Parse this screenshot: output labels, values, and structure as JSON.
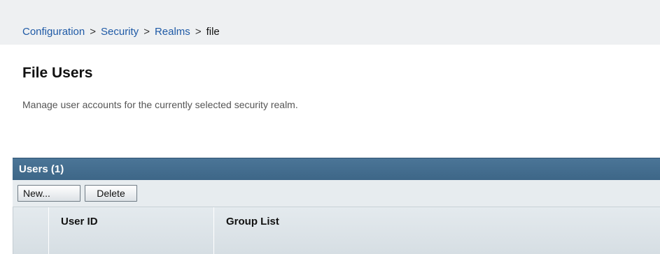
{
  "breadcrumb": {
    "items": [
      "Configuration",
      "Security",
      "Realms"
    ],
    "separator": ">",
    "current": "file"
  },
  "page": {
    "title": "File Users",
    "description": "Manage user accounts for the currently selected security realm."
  },
  "users_table": {
    "title": "Users (1)",
    "buttons": {
      "new_label": "New...",
      "delete_label": "Delete"
    },
    "columns": [
      "User ID",
      "Group List"
    ]
  },
  "colors": {
    "panel_header": "#4b7597",
    "link": "#1f5aa6",
    "toolbar_bg": "#e7ecef",
    "breadcrumb_bg": "#eef0f2"
  }
}
